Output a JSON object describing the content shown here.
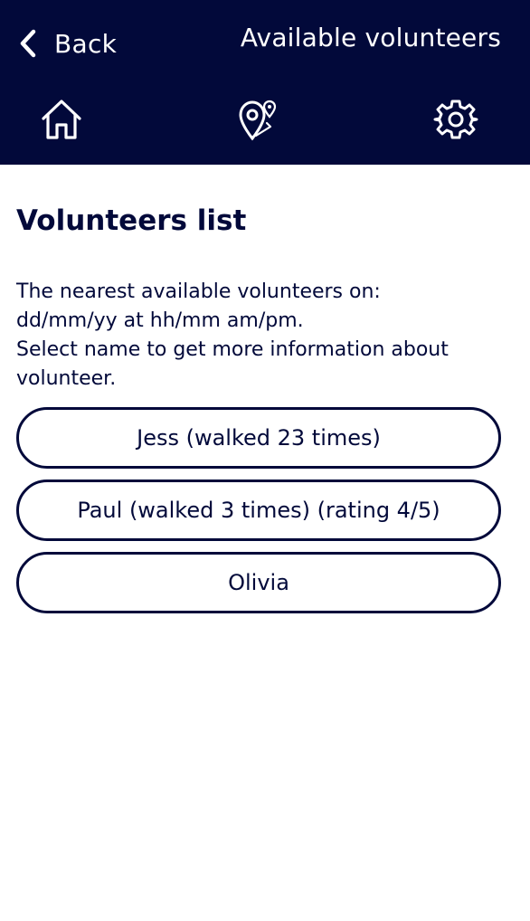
{
  "header": {
    "back_label": "Back",
    "title": "Available volunteers",
    "background_color": "#02093a",
    "nav": [
      {
        "icon": "home-icon"
      },
      {
        "icon": "map-pin-icon"
      },
      {
        "icon": "gear-icon"
      }
    ]
  },
  "main": {
    "title": "Volunteers list",
    "description": "The nearest available volunteers on:\ndd/mm/yy at hh/mm am/pm.\nSelect name to get more information about volunteer.",
    "volunteers": [
      {
        "label": "Jess (walked 23 times)"
      },
      {
        "label": "Paul (walked 3 times) (rating 4/5)"
      },
      {
        "label": "Olivia"
      }
    ]
  }
}
